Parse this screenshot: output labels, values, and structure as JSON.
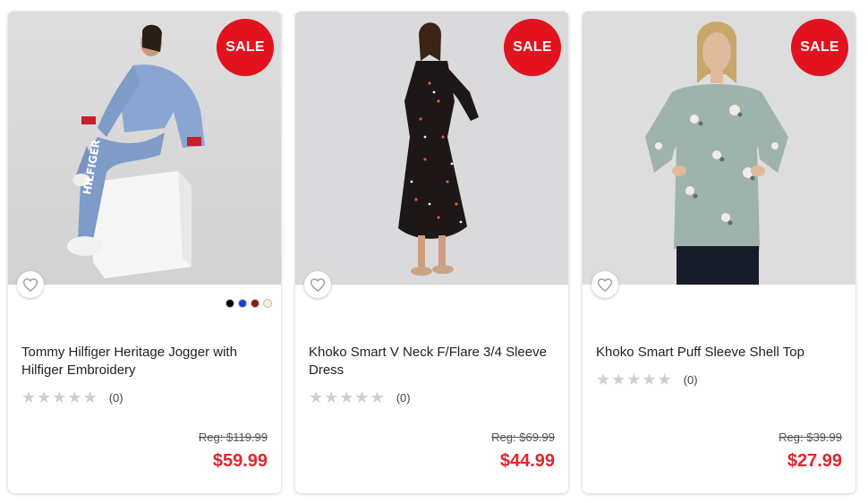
{
  "colors": {
    "sale_badge": "#e2131f",
    "price": "#e0262e",
    "star_empty": "#cfcfcf"
  },
  "products": [
    {
      "badge": "SALE",
      "image_alt": "Model in blue Tommy Hilfiger hoodie and joggers sitting on a white block",
      "swatches": [
        "#000000",
        "#1a3fd0",
        "#8b1a1a",
        "#f3efdc"
      ],
      "title": "Tommy Hilfiger Heritage Jogger with Hilfiger Embroidery",
      "stars_text": "★★★★★",
      "rating_count": "(0)",
      "reg_price": "Reg: $119.99",
      "sale_price": "$59.99"
    },
    {
      "badge": "SALE",
      "image_alt": "Model in black printed V neck 3/4 sleeve dress",
      "title": "Khoko Smart V Neck F/Flare 3/4 Sleeve Dress",
      "stars_text": "★★★★★",
      "rating_count": "(0)",
      "reg_price": "Reg: $69.99",
      "sale_price": "$44.99"
    },
    {
      "badge": "SALE",
      "image_alt": "Model in sage floral puff sleeve top and navy pants",
      "title": "Khoko Smart Puff Sleeve Shell Top",
      "stars_text": "★★★★★",
      "rating_count": "(0)",
      "reg_price": "Reg: $39.99",
      "sale_price": "$27.99"
    }
  ]
}
